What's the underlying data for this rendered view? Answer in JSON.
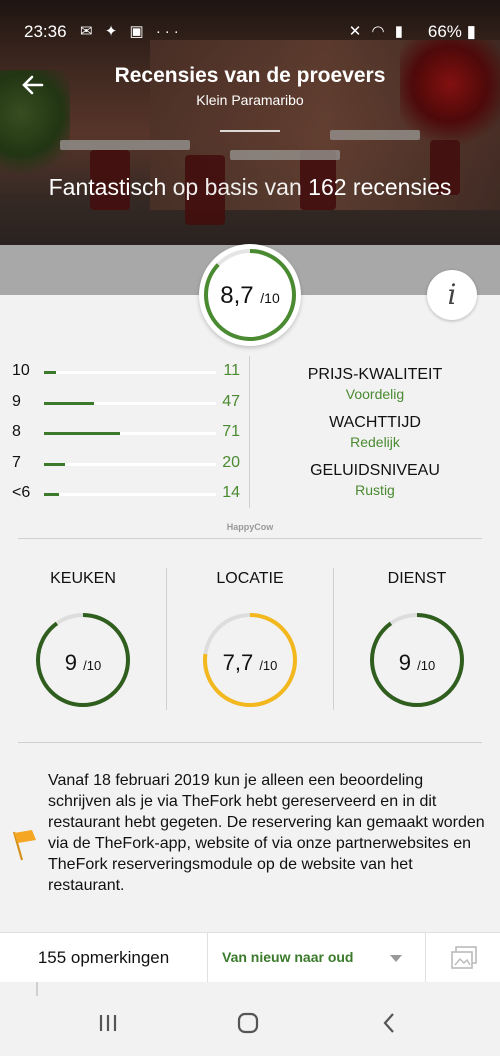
{
  "status_bar": {
    "time": "23:36",
    "battery": "66%",
    "more": "···"
  },
  "header": {
    "title": "Recensies van de proevers",
    "subtitle": "Klein Paramaribo",
    "headline_rating_word": "Fantastisch",
    "headline_mid": " op basis van ",
    "headline_count": "162 recensies"
  },
  "overall": {
    "score": "8,7",
    "out_of": "/10",
    "score_fraction": 0.87
  },
  "distribution": [
    {
      "label": "10",
      "count": "11",
      "fraction": 0.07
    },
    {
      "label": "9",
      "count": "47",
      "fraction": 0.29
    },
    {
      "label": "8",
      "count": "71",
      "fraction": 0.44
    },
    {
      "label": "7",
      "count": "20",
      "fraction": 0.12
    },
    {
      "label": "<6",
      "count": "14",
      "fraction": 0.09
    }
  ],
  "attributes": [
    {
      "key": "PRIJS-KWALITEIT",
      "value": "Voordelig"
    },
    {
      "key": "WACHTTIJD",
      "value": "Redelijk"
    },
    {
      "key": "GELUIDSNIVEAU",
      "value": "Rustig"
    }
  ],
  "credit": "HappyCow",
  "sub_scores": [
    {
      "name": "KEUKEN",
      "score": "9",
      "out_of": "/10",
      "fraction": 0.9,
      "color": "#2f5e1e"
    },
    {
      "name": "LOCATIE",
      "score": "7,7",
      "out_of": "/10",
      "fraction": 0.77,
      "color": "#f2b81d"
    },
    {
      "name": "DIENST",
      "score": "9",
      "out_of": "/10",
      "fraction": 0.9,
      "color": "#2f5e1e"
    }
  ],
  "notice": "Vanaf 18 februari 2019 kun je alleen een beoordeling schrijven als je via TheFork hebt gereserveerd en in dit restaurant hebt gegeten. De reservering kan gemaakt worden via de TheFork-app, website of via onze partnerwebsites en TheFork reserveringsmodule op de website van het restaurant.",
  "bottom_bar": {
    "comments": "155 opmerkingen",
    "sort": "Van nieuw naar oud"
  },
  "colors": {
    "accent_green": "#4a8a30",
    "flag": "#f5a623"
  }
}
